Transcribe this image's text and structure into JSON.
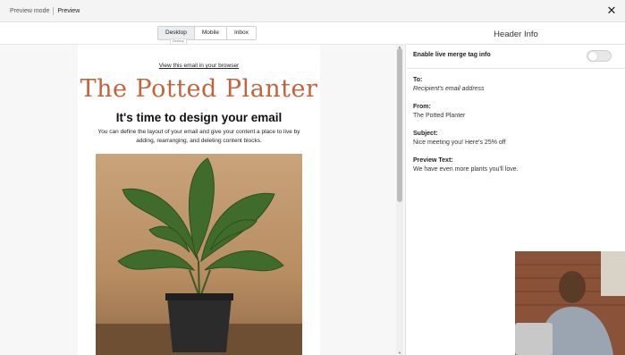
{
  "topbar": {
    "mode_label": "Preview mode",
    "crumb": "Preview",
    "close_icon": "close-icon"
  },
  "tabs": {
    "items": [
      "Desktop",
      "Mobile",
      "Inbox"
    ],
    "active": "Desktop",
    "tooltip": "Desktop"
  },
  "email": {
    "view_link": "View this email in your browser",
    "brand": "The Potted Planter",
    "headline": "It's time to design your email",
    "body_line1": "You can define the layout of your email and give your content a place to live by",
    "body_line2": "adding, rearranging, and deleting content blocks."
  },
  "header_info": {
    "title": "Header Info",
    "merge_label": "Enable live merge tag info",
    "merge_enabled": false,
    "to_label": "To:",
    "to_value": "Recipient's email address",
    "from_label": "From:",
    "from_value": "The Potted Planter",
    "subject_label": "Subject:",
    "subject_value": "Nice meeting you! Here's 25% off",
    "preview_label": "Preview Text:",
    "preview_value": "We have even more plants you'll love."
  },
  "colors": {
    "brand": "#c2643b",
    "panel_bg": "#f7f7f7"
  }
}
